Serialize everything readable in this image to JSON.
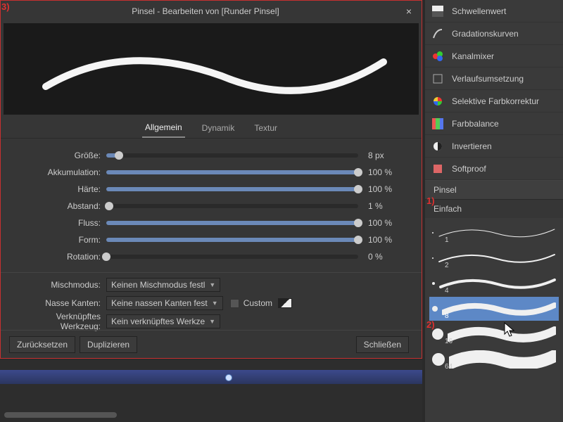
{
  "dialog": {
    "title": "Pinsel - Bearbeiten von [Runder Pinsel]",
    "close": "×",
    "tabs": {
      "general": "Allgemein",
      "dynamic": "Dynamik",
      "texture": "Textur"
    },
    "sliders": [
      {
        "label": "Größe:",
        "value": "8 px",
        "pct": 5
      },
      {
        "label": "Akkumulation:",
        "value": "100 %",
        "pct": 100
      },
      {
        "label": "Härte:",
        "value": "100 %",
        "pct": 100
      },
      {
        "label": "Abstand:",
        "value": "1 %",
        "pct": 1
      },
      {
        "label": "Fluss:",
        "value": "100 %",
        "pct": 100
      },
      {
        "label": "Form:",
        "value": "100 %",
        "pct": 100
      },
      {
        "label": "Rotation:",
        "value": "0 %",
        "pct": 0
      }
    ],
    "selects": {
      "blend_label": "Mischmodus:",
      "blend_value": "Keinen Mischmodus festl",
      "wet_label": "Nasse Kanten:",
      "wet_value": "Keine nassen Kanten fest",
      "custom_label": "Custom",
      "tool_label": "Verknüpftes Werkzeug:",
      "tool_value": "Kein verknüpftes Werkze"
    },
    "footer": {
      "reset": "Zurücksetzen",
      "duplicate": "Duplizieren",
      "close": "Schließen"
    }
  },
  "adjustments": [
    "Schwellenwert",
    "Gradationskurven",
    "Kanalmixer",
    "Verlaufsumsetzung",
    "Selektive Farbkorrektur",
    "Farbbalance",
    "Invertieren",
    "Softproof"
  ],
  "brush_panel": {
    "title": "Pinsel",
    "category": "Einfach"
  },
  "brushes": [
    {
      "size": 1,
      "thick": 1
    },
    {
      "size": 2,
      "thick": 2
    },
    {
      "size": 4,
      "thick": 4
    },
    {
      "size": 8,
      "thick": 8,
      "selected": true
    },
    {
      "size": 16,
      "thick": 12
    },
    {
      "size": 64,
      "thick": 18
    }
  ],
  "annotations": {
    "one": "1)",
    "two": "2)",
    "three": "3)"
  }
}
